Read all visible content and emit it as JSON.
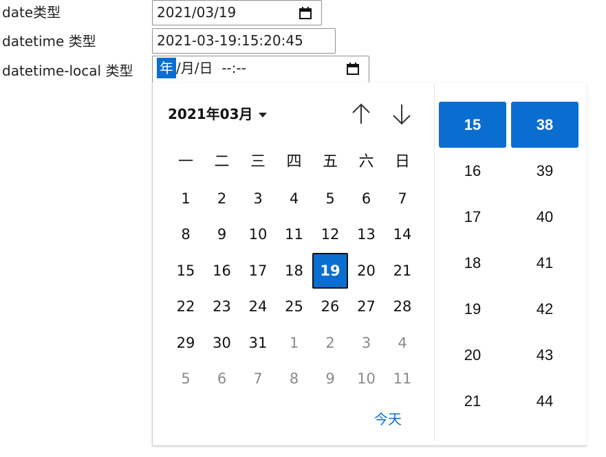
{
  "rows": [
    {
      "label": "date类型",
      "value": "2021/03/19"
    },
    {
      "label": "datetime 类型",
      "value": "2021-03-19:15:20:45"
    },
    {
      "label": "datetime-local 类型",
      "segment_year": "年",
      "rest": "/月/日  --:--"
    }
  ],
  "picker": {
    "month_label": "2021年03月",
    "weekdays": [
      "一",
      "二",
      "三",
      "四",
      "五",
      "六",
      "日"
    ],
    "weeks": [
      [
        "1",
        "2",
        "3",
        "4",
        "5",
        "6",
        "7"
      ],
      [
        "8",
        "9",
        "10",
        "11",
        "12",
        "13",
        "14"
      ],
      [
        "15",
        "16",
        "17",
        "18",
        "19",
        "20",
        "21"
      ],
      [
        "22",
        "23",
        "24",
        "25",
        "26",
        "27",
        "28"
      ],
      [
        "29",
        "30",
        "31",
        "1",
        "2",
        "3",
        "4"
      ],
      [
        "5",
        "6",
        "7",
        "8",
        "9",
        "10",
        "11"
      ]
    ],
    "selected_day": "19",
    "today_label": "今天",
    "hours": [
      "15",
      "16",
      "17",
      "18",
      "19",
      "20",
      "21"
    ],
    "minutes": [
      "38",
      "39",
      "40",
      "41",
      "42",
      "43",
      "44"
    ],
    "selected_hour": "15",
    "selected_minute": "38"
  },
  "colors": {
    "accent": "#0a6ed1"
  },
  "icons": [
    "calendar-icon",
    "arrow-up-icon",
    "arrow-down-icon",
    "caret-down-icon"
  ]
}
